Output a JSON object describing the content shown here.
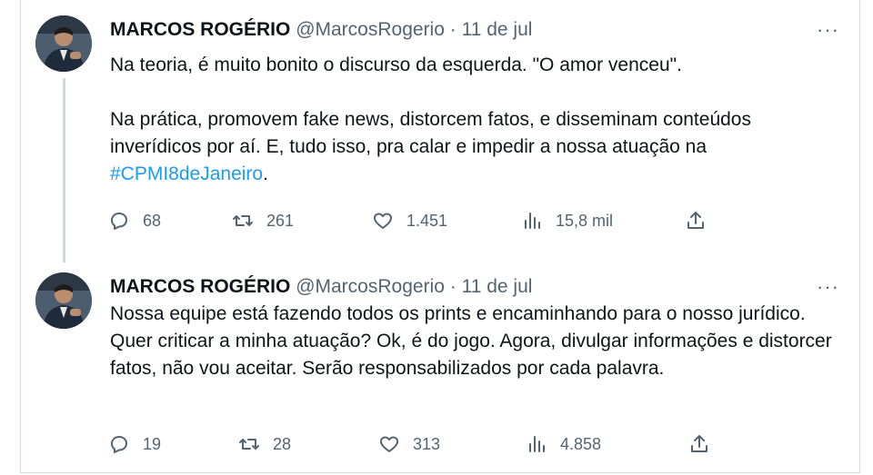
{
  "tweets": [
    {
      "author_name": "MARCOS ROGÉRIO",
      "handle": "@MarcosRogerio",
      "separator": "·",
      "date": "11 de jul",
      "more": "···",
      "paragraphs": [
        "Na teoria, é muito bonito o discurso da esquerda. \"O amor venceu\".",
        "Na prática, promovem fake news, distorcem fatos, e disseminam conteúdos inverídicos por aí. E, tudo isso, pra calar e impedir a nossa atuação na "
      ],
      "hashtag": "#CPMI8deJaneiro",
      "hashtag_suffix": ".",
      "stats": {
        "replies": "68",
        "retweets": "261",
        "likes": "1.451",
        "views": "15,8 mil"
      }
    },
    {
      "author_name": "MARCOS ROGÉRIO",
      "handle": "@MarcosRogerio",
      "separator": "·",
      "date": "11 de jul",
      "more": "···",
      "paragraphs": [
        "Nossa equipe está fazendo todos os prints e encaminhando para o nosso jurídico. Quer criticar a minha atuação? Ok, é do jogo. Agora, divulgar informações e distorcer fatos, não vou aceitar. Serão responsabilizados por cada palavra."
      ],
      "stats": {
        "replies": "19",
        "retweets": "28",
        "likes": "313",
        "views": "4.858"
      }
    }
  ],
  "icons": [
    "avatar",
    "reply-icon",
    "retweet-icon",
    "like-icon",
    "views-icon",
    "share-icon",
    "more-icon"
  ],
  "colors": {
    "text": "#0f1419",
    "secondary": "#536471",
    "link": "#1d9bf0",
    "border": "#cfd9de"
  }
}
